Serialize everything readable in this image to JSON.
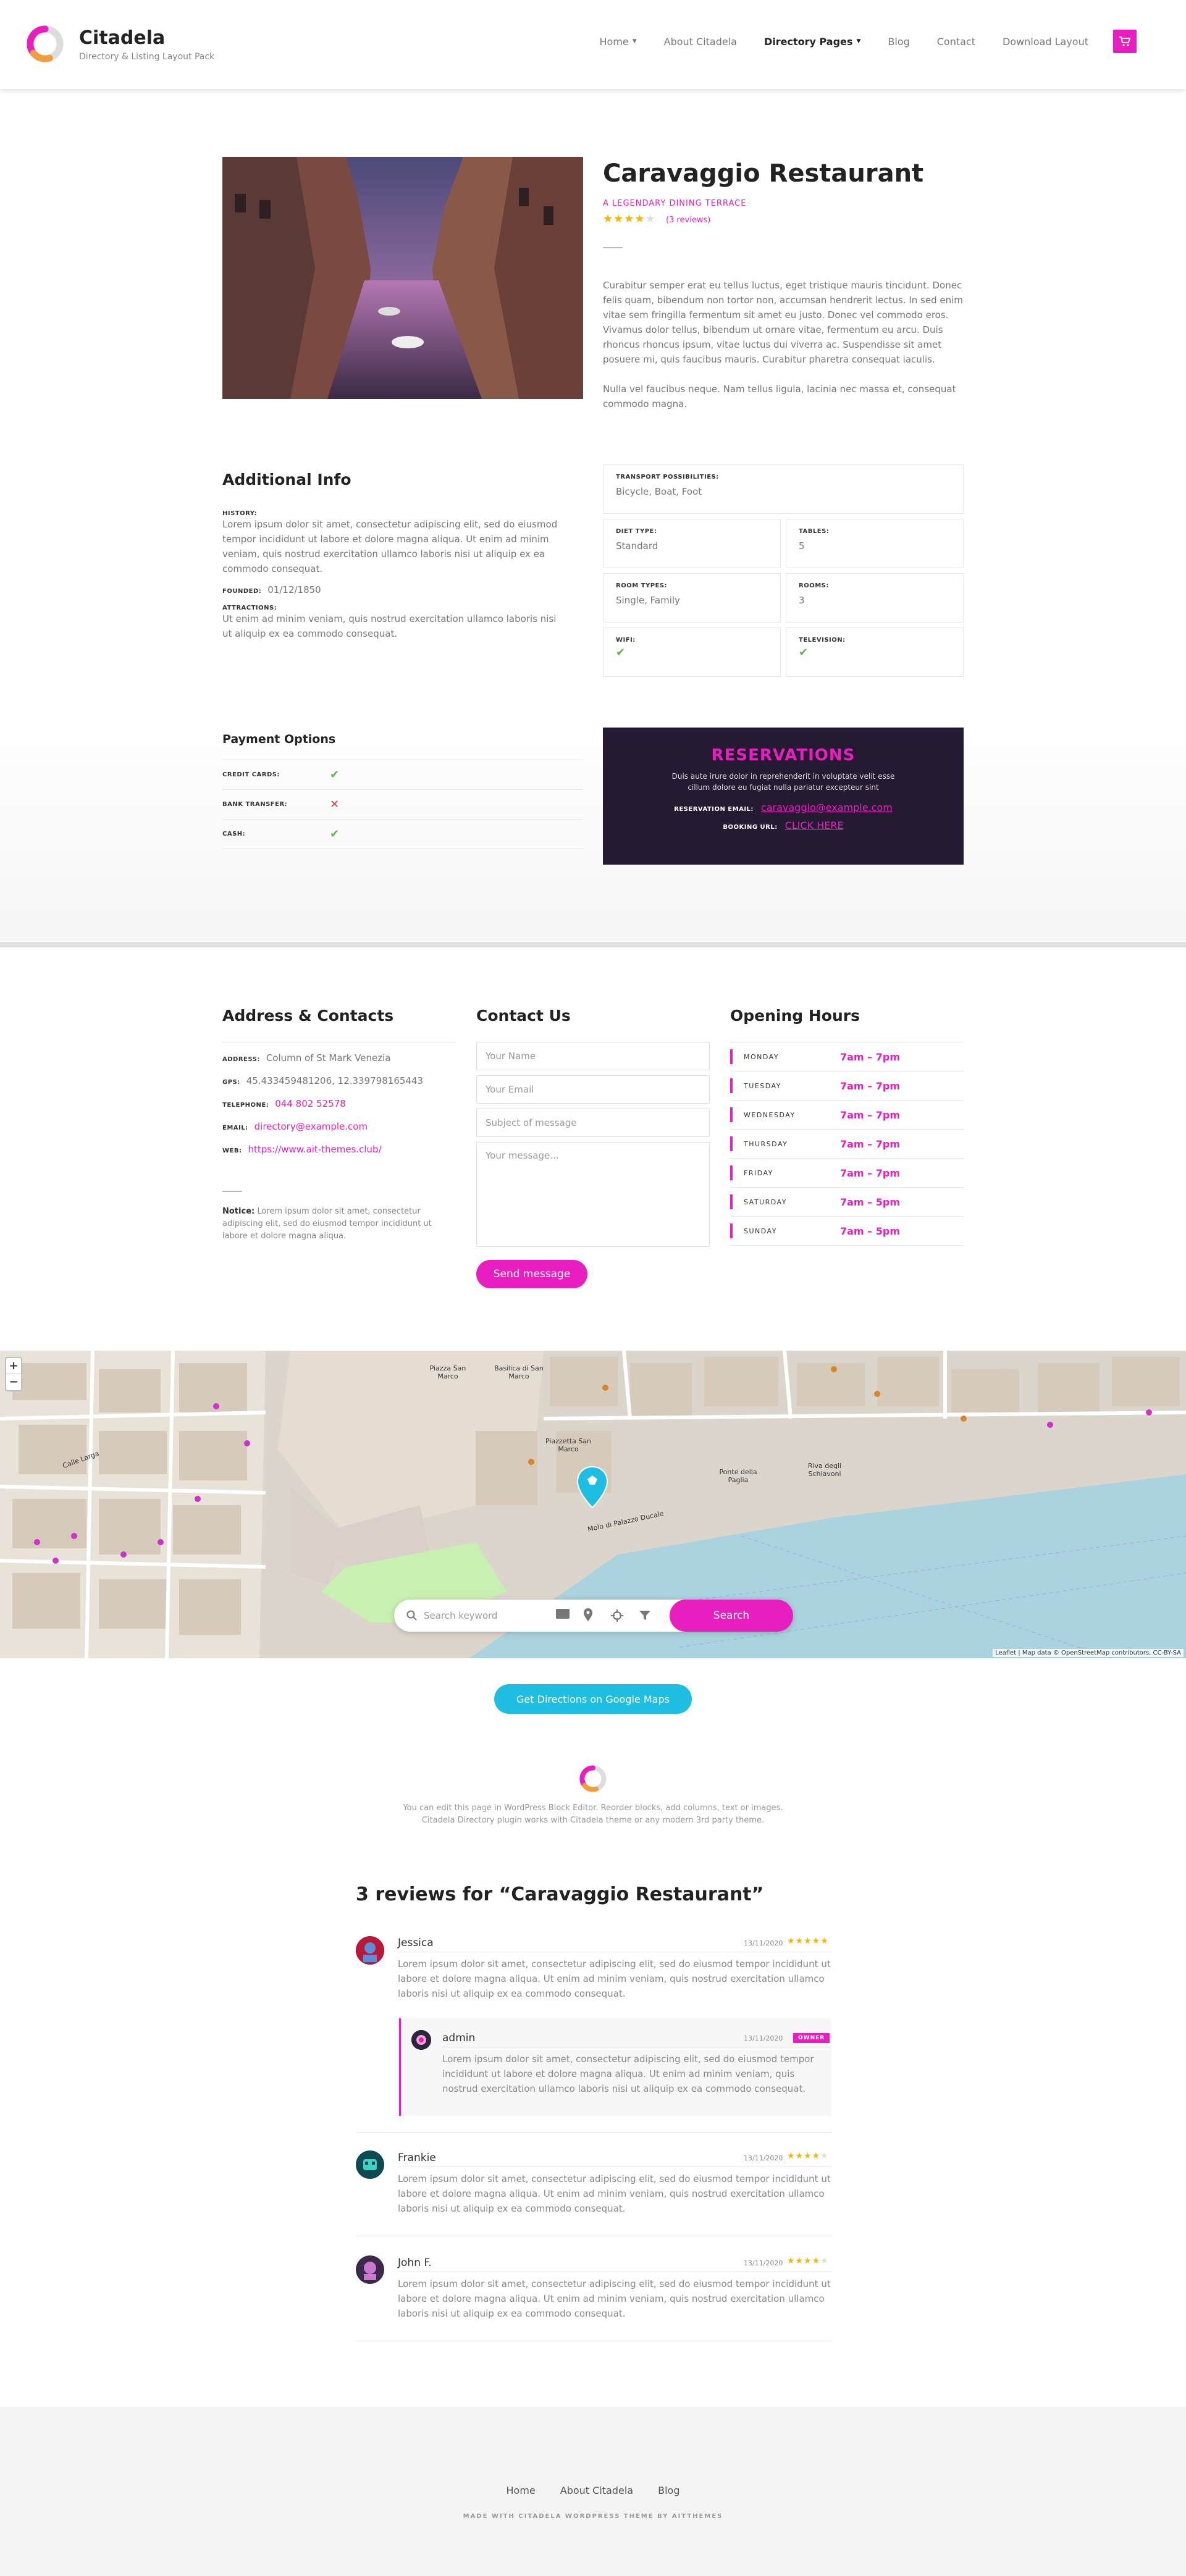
{
  "header": {
    "brand": "Citadela",
    "tagline": "Directory & Listing Layout Pack",
    "nav": [
      {
        "label": "Home",
        "dropdown": true
      },
      {
        "label": "About Citadela",
        "dropdown": false
      },
      {
        "label": "Directory Pages",
        "dropdown": true
      },
      {
        "label": "Blog",
        "dropdown": false
      },
      {
        "label": "Contact",
        "dropdown": false
      },
      {
        "label": "Download Layout",
        "dropdown": false
      }
    ],
    "cart_icon": "cart-icon"
  },
  "listing": {
    "title": "Caravaggio Restaurant",
    "subtitle": "A LEGENDARY DINING TERRACE",
    "rating": 4,
    "reviews_link": "(3 reviews)",
    "description": [
      "Curabitur semper erat eu tellus luctus, eget tristique mauris tincidunt. Donec felis quam, bibendum non tortor non, accumsan hendrerit lectus. In sed enim vitae sem fringilla fermentum sit amet eu justo. Donec vel commodo eros. Vivamus dolor tellus, bibendum ut ornare vitae, fermentum eu arcu. Duis rhoncus rhoncus ipsum, vitae luctus dui viverra ac. Suspendisse sit amet posuere mi, quis faucibus mauris. Curabitur pharetra consequat iaculis.",
      "Nulla vel faucibus neque. Nam tellus ligula, lacinia nec massa et, consequat commodo magna."
    ]
  },
  "additional_info": {
    "heading": "Additional Info",
    "history_label": "HISTORY:",
    "history": "Lorem ipsum dolor sit amet, consectetur adipiscing elit, sed do eiusmod tempor incididunt ut labore et dolore magna aliqua. Ut enim ad minim veniam, quis nostrud exercitation ullamco laboris nisi ut aliquip ex ea commodo consequat.",
    "founded_label": "FOUNDED:",
    "founded": "01/12/1850",
    "attractions_label": "ATTRACTIONS:",
    "attractions": "Ut enim ad minim veniam, quis nostrud exercitation ullamco laboris nisi ut aliquip ex ea commodo consequat.",
    "transport_label": "TRANSPORT POSSIBILITIES:",
    "transport": "Bicycle, Boat, Foot",
    "diet_label": "DIET TYPE:",
    "diet": "Standard",
    "tables_label": "TABLES:",
    "tables": "5",
    "room_types_label": "ROOM TYPES:",
    "room_types": "Single, Family",
    "rooms_label": "ROOMS:",
    "rooms": "3",
    "wifi_label": "WIFI:",
    "tv_label": "TELEVISION:",
    "check_icon": "check-icon"
  },
  "payment": {
    "heading": "Payment Options",
    "rows": [
      {
        "label": "CREDIT CARDS:",
        "accepted": true
      },
      {
        "label": "BANK TRANSFER:",
        "accepted": false
      },
      {
        "label": "CASH:",
        "accepted": true
      }
    ]
  },
  "reservations": {
    "title": "RESERVATIONS",
    "text": "Duis aute irure dolor in reprehenderit in voluptate velit esse cillum dolore eu fugiat nulla pariatur excepteur sint",
    "email_label": "RESERVATION EMAIL:",
    "email": "caravaggio@example.com",
    "booking_label": "BOOKING URL:",
    "booking": "CLICK HERE"
  },
  "address": {
    "heading": "Address & Contacts",
    "address_label": "ADDRESS:",
    "address": "Column of St Mark Venezia",
    "gps_label": "GPS:",
    "gps": "45.433459481206, 12.339798165443",
    "telephone_label": "TELEPHONE:",
    "telephone": "044 802 52578",
    "email_label": "EMAIL:",
    "email": "directory@example.com",
    "web_label": "WEB:",
    "web": "https://www.ait-themes.club/",
    "notice_label": "Notice:",
    "notice": "Lorem ipsum dolor sit amet, consectetur adipiscing elit, sed do eiusmod tempor incididunt ut labore et dolore magna aliqua."
  },
  "contact": {
    "heading": "Contact Us",
    "name_placeholder": "Your Name",
    "email_placeholder": "Your Email",
    "subject_placeholder": "Subject of message",
    "message_placeholder": "Your message...",
    "send": "Send message"
  },
  "hours": {
    "heading": "Opening Hours",
    "days": [
      {
        "day": "MONDAY",
        "hours": "7am – 7pm"
      },
      {
        "day": "TUESDAY",
        "hours": "7am – 7pm"
      },
      {
        "day": "WEDNESDAY",
        "hours": "7am – 7pm"
      },
      {
        "day": "THURSDAY",
        "hours": "7am – 7pm"
      },
      {
        "day": "FRIDAY",
        "hours": "7am – 7pm"
      },
      {
        "day": "SATURDAY",
        "hours": "7am – 5pm"
      },
      {
        "day": "SUNDAY",
        "hours": "7am – 5pm"
      }
    ]
  },
  "map": {
    "zoom_in": "+",
    "zoom_out": "−",
    "labels": [
      "Piazza San Marco",
      "Basilica di San Marco",
      "Piazzetta San Marco",
      "Riva degli Schiavoni",
      "Molo di Palazzo Ducale",
      "Ponte della Paglia",
      "Calle Larga",
      "Piazza San Marco"
    ],
    "search_placeholder": "Search keyword",
    "search_button": "Search",
    "attribution": "Leaflet | Map data © OpenStreetMap contributors, CC-BY-SA",
    "directions": "Get Directions on Google Maps"
  },
  "blurb": {
    "line1": "You can edit this page in WordPress Block Editor. Reorder blocks, add columns, text or images.",
    "line2": "Citadela Directory plugin works with Citadela theme or any modern 3rd party theme."
  },
  "reviews": {
    "heading": "3 reviews for “Caravaggio Restaurant”",
    "items": [
      {
        "name": "Jessica",
        "date": "13/11/2020",
        "rating": 5,
        "text": "Lorem ipsum dolor sit amet, consectetur adipiscing elit, sed do eiusmod tempor incididunt ut labore et dolore magna aliqua. Ut enim ad minim veniam, quis nostrud exercitation ullamco laboris nisi ut aliquip ex ea commodo consequat."
      },
      {
        "name": "admin",
        "date": "13/11/2020",
        "badge": "OWNER",
        "text": "Lorem ipsum dolor sit amet, consectetur adipiscing elit, sed do eiusmod tempor incididunt ut labore et dolore magna aliqua. Ut enim ad minim veniam, quis nostrud exercitation ullamco laboris nisi ut aliquip ex ea commodo consequat."
      },
      {
        "name": "Frankie",
        "date": "13/11/2020",
        "rating": 4,
        "text": "Lorem ipsum dolor sit amet, consectetur adipiscing elit, sed do eiusmod tempor incididunt ut labore et dolore magna aliqua. Ut enim ad minim veniam, quis nostrud exercitation ullamco laboris nisi ut aliquip ex ea commodo consequat."
      },
      {
        "name": "John F.",
        "date": "13/11/2020",
        "rating": 4,
        "text": "Lorem ipsum dolor sit amet, consectetur adipiscing elit, sed do eiusmod tempor incididunt ut labore et dolore magna aliqua. Ut enim ad minim veniam, quis nostrud exercitation ullamco laboris nisi ut aliquip ex ea commodo consequat."
      }
    ]
  },
  "footer": {
    "nav": [
      "Home",
      "About Citadela",
      "Blog"
    ],
    "copyright": "MADE WITH CITADELA WORDPRESS THEME BY AITTHEMES"
  },
  "colors": {
    "accent": "#e91ec0",
    "secondary": "#1ebde2",
    "dark": "#241a32",
    "success": "#63b34d",
    "danger": "#e53935"
  }
}
